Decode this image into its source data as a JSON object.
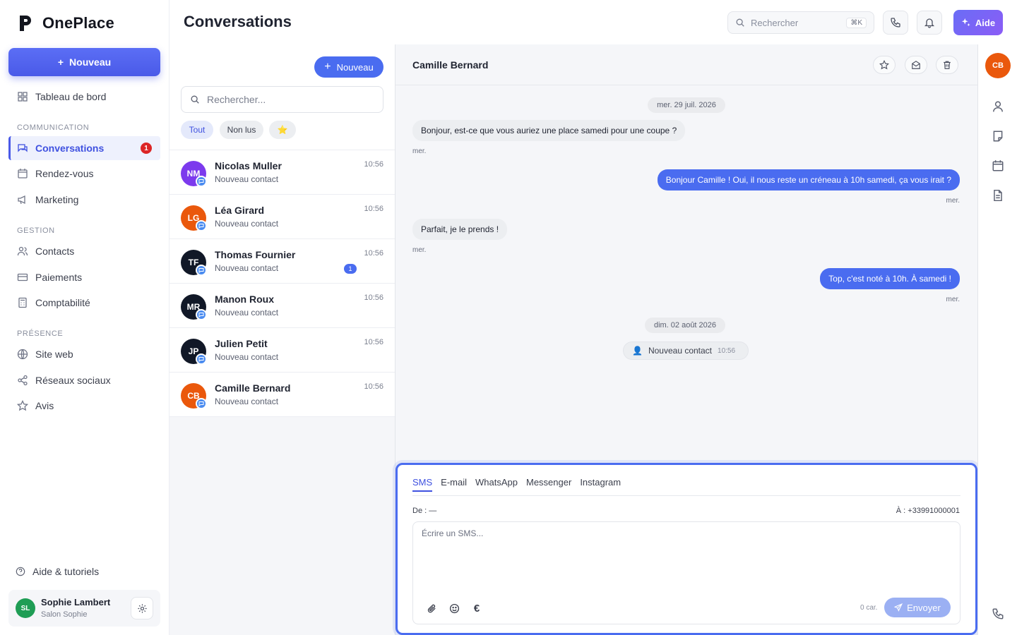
{
  "app": {
    "name": "OnePlace"
  },
  "sidebar": {
    "new_button": "Nouveau",
    "dashboard": "Tableau de bord",
    "sections": {
      "communication": "COMMUNICATION",
      "gestion": "GESTION",
      "presence": "PRÉSENCE"
    },
    "items": {
      "conversations": "Conversations",
      "conversations_badge": "1",
      "rendezvous": "Rendez-vous",
      "marketing": "Marketing",
      "contacts": "Contacts",
      "paiements": "Paiements",
      "comptabilite": "Comptabilité",
      "siteweb": "Site web",
      "reseaux": "Réseaux sociaux",
      "avis": "Avis"
    },
    "help": "Aide & tutoriels",
    "user": {
      "initials": "SL",
      "name": "Sophie Lambert",
      "company": "Salon Sophie",
      "avatar_color": "#1f9d55"
    }
  },
  "header": {
    "title": "Conversations",
    "search_placeholder": "Rechercher",
    "search_shortcut": "⌘K",
    "help_button": "Aide"
  },
  "conv_list": {
    "new_button": "Nouveau",
    "search_placeholder": "Rechercher...",
    "filters": {
      "all": "Tout",
      "unread": "Non lus",
      "starred": "⭐"
    },
    "items": [
      {
        "initials": "NM",
        "name": "Nicolas Muller",
        "subtitle": "Nouveau contact",
        "time": "10:56",
        "color": "#7c3aed"
      },
      {
        "initials": "LG",
        "name": "Léa Girard",
        "subtitle": "Nouveau contact",
        "time": "10:56",
        "color": "#ea580c"
      },
      {
        "initials": "TF",
        "name": "Thomas Fournier",
        "subtitle": "Nouveau contact",
        "time": "10:56",
        "color": "#111827",
        "unread": "1"
      },
      {
        "initials": "MR",
        "name": "Manon Roux",
        "subtitle": "Nouveau contact",
        "time": "10:56",
        "color": "#111827"
      },
      {
        "initials": "JP",
        "name": "Julien Petit",
        "subtitle": "Nouveau contact",
        "time": "10:56",
        "color": "#111827"
      },
      {
        "initials": "CB",
        "name": "Camille Bernard",
        "subtitle": "Nouveau contact",
        "time": "10:56",
        "color": "#ea580c"
      }
    ]
  },
  "chat": {
    "contact_name": "Camille Bernard",
    "date1": "mer. 29 juil. 2026",
    "messages": [
      {
        "dir": "in",
        "text": "Bonjour, est-ce que vous auriez une place samedi pour une coupe ?",
        "time": "mer."
      },
      {
        "dir": "out",
        "text": "Bonjour Camille ! Oui, il nous reste un créneau à 10h samedi, ça vous irait ?",
        "time": "mer."
      },
      {
        "dir": "in",
        "text": "Parfait, je le prends !",
        "time": "mer."
      },
      {
        "dir": "out",
        "text": "Top, c'est noté à 10h. À samedi !",
        "time": "mer."
      }
    ],
    "date2": "dim. 02 août 2026",
    "event": {
      "icon": "👤",
      "text": "Nouveau contact",
      "time": "10:56"
    }
  },
  "composer": {
    "tabs": [
      "SMS",
      "E-mail",
      "WhatsApp",
      "Messenger",
      "Instagram"
    ],
    "from_label": "De :",
    "from_value": "—",
    "to_label": "À :",
    "to_value": "+33991000001",
    "placeholder": "Écrire un SMS...",
    "char_count": "0 car.",
    "send": "Envoyer",
    "currency_glyph": "€"
  },
  "rail": {
    "avatar_initials": "CB",
    "avatar_color": "#ea580c"
  },
  "colors": {
    "accent": "#4a6cf0",
    "brand_gradient_start": "#6a6df6",
    "danger": "#dc2626"
  }
}
